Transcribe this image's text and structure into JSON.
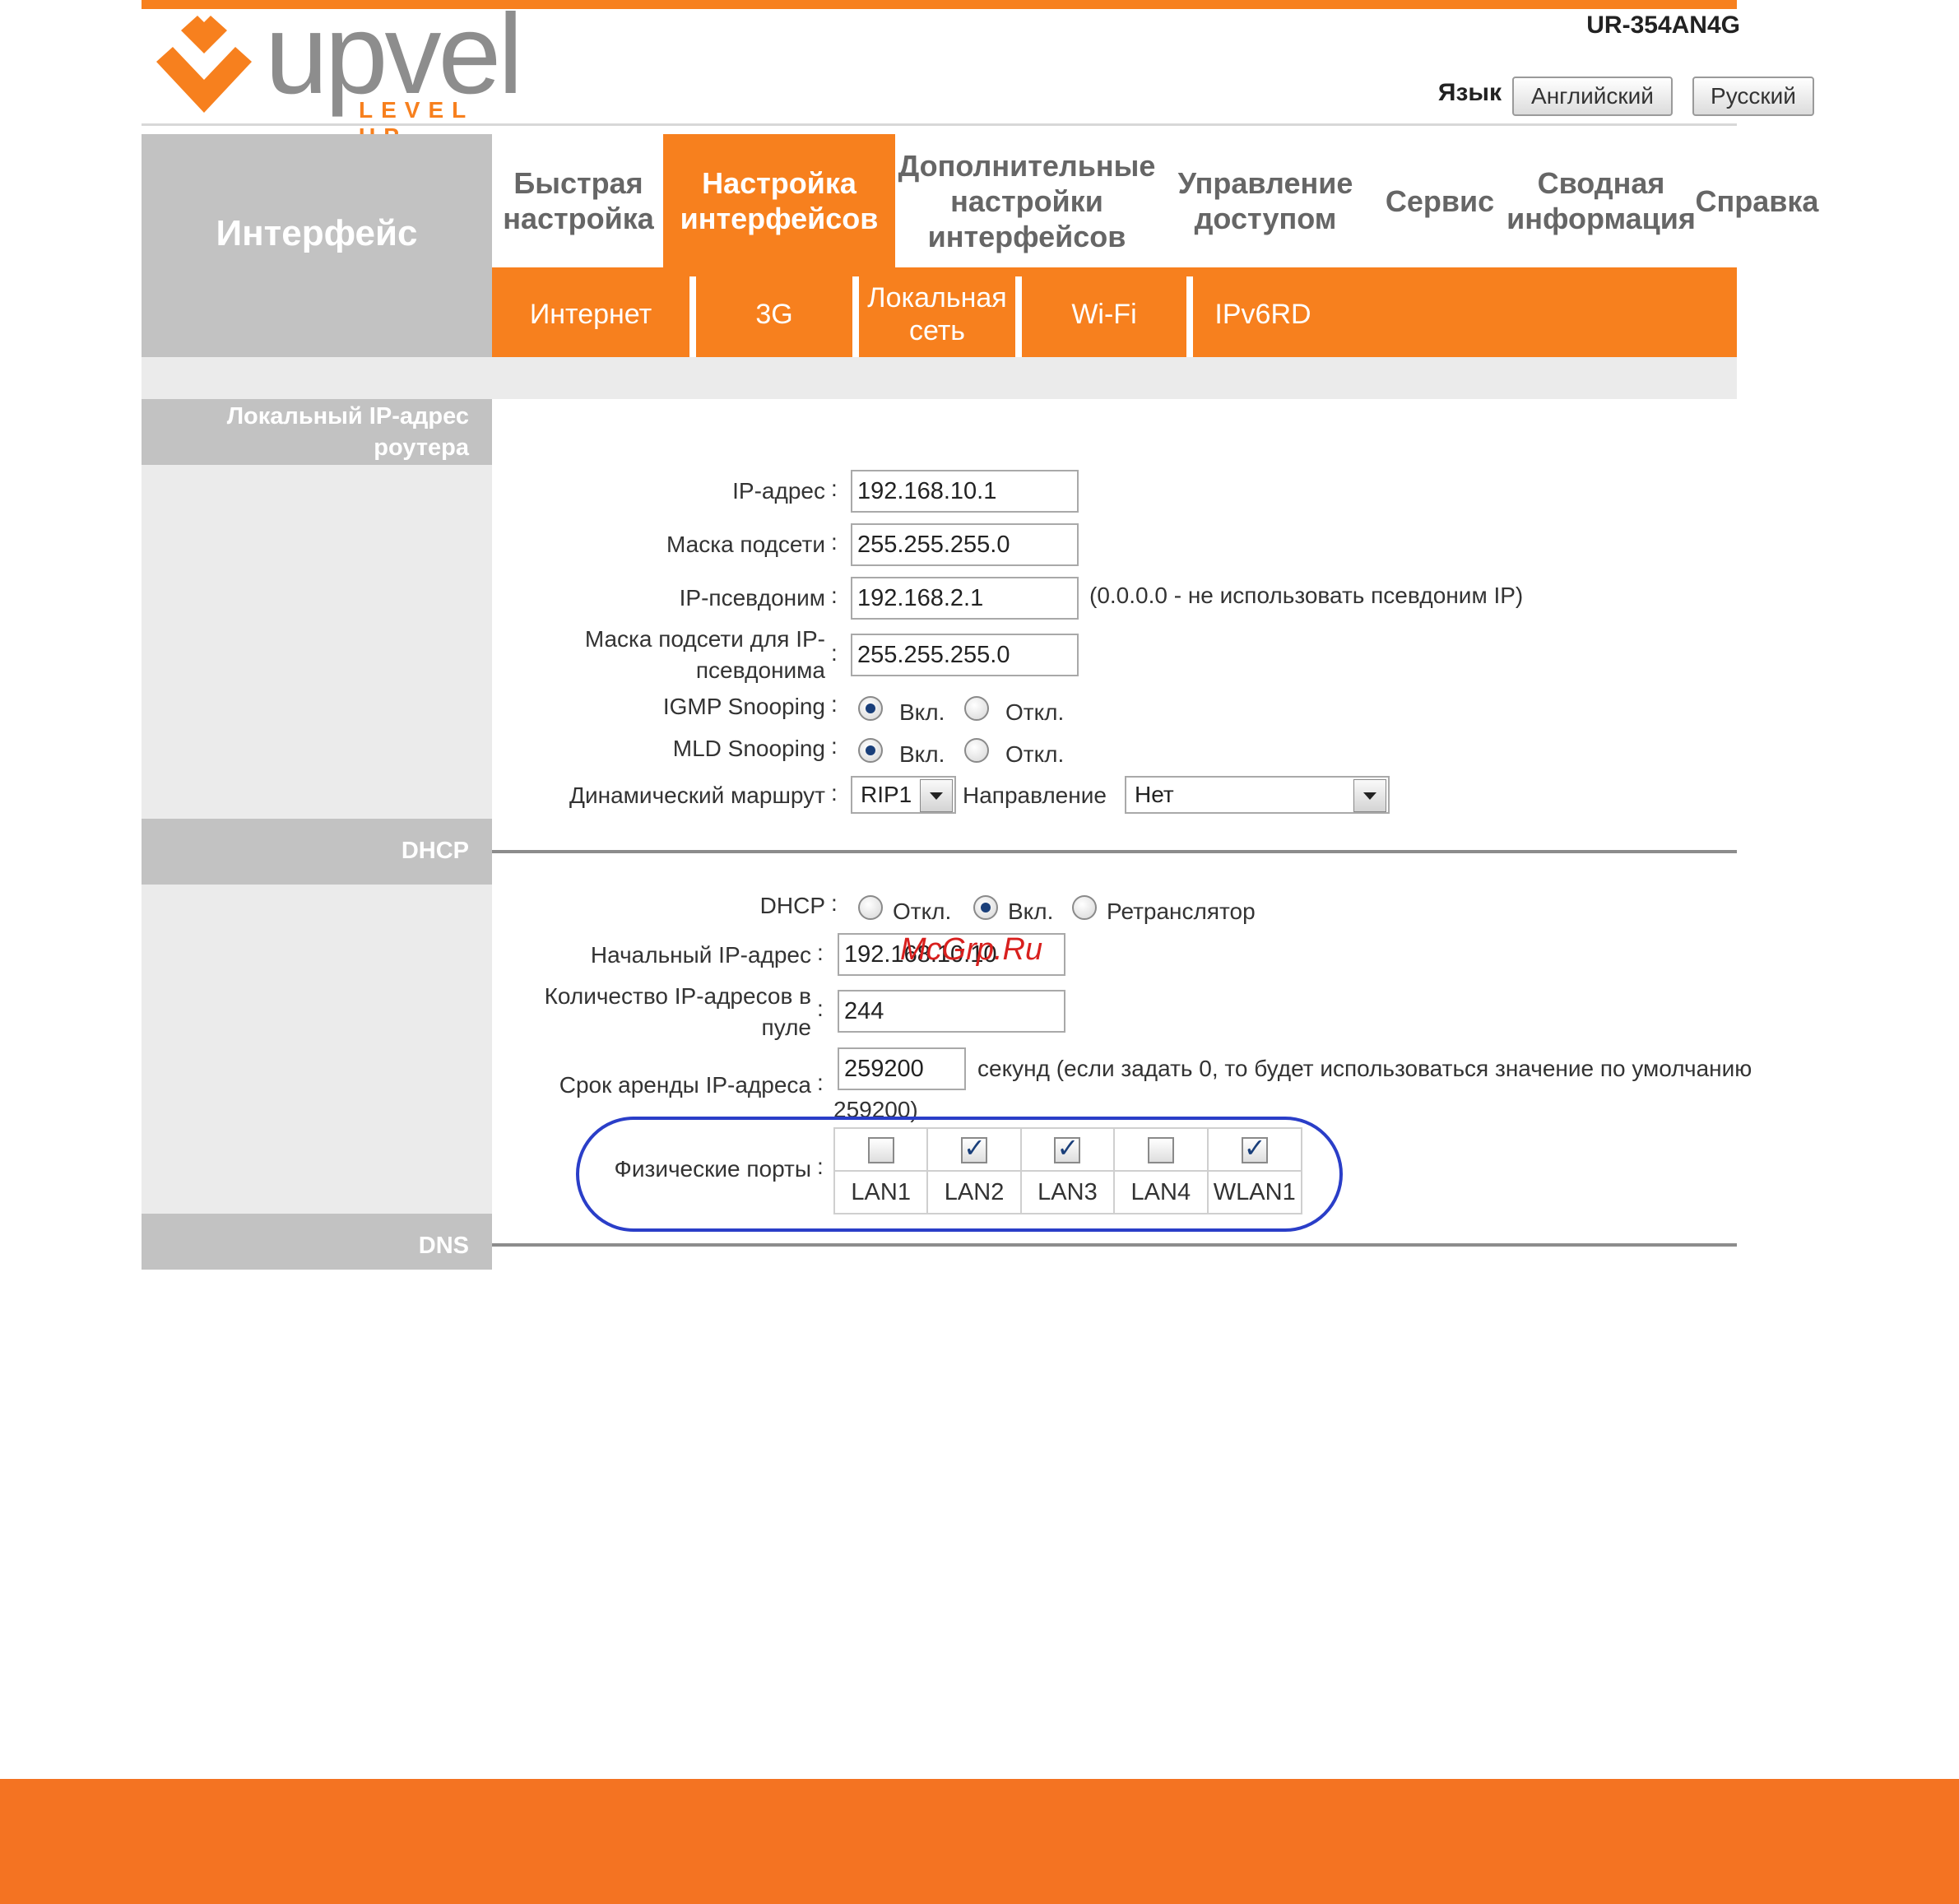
{
  "brand": {
    "logo_word": "upvel",
    "logo_tagline": "LEVEL UP",
    "model": "UR-354AN4G",
    "accent_color": "#f7801e"
  },
  "language": {
    "label": "Язык",
    "buttons": [
      "Английский",
      "Русский"
    ]
  },
  "sidebar": {
    "title": "Интерфейс"
  },
  "nav": {
    "items": [
      "Быстрая настройка",
      "Настройка интерфейсов",
      "Дополнительные настройки интерфейсов",
      "Управление доступом",
      "Сервис",
      "Сводная информация",
      "Справка"
    ],
    "active": "Настройка интерфейсов"
  },
  "subnav": {
    "items": [
      "Интернет",
      "3G",
      "Локальная сеть",
      "Wi-Fi",
      "IPv6RD"
    ]
  },
  "sections": {
    "lan": "Локальный IP-адрес роутера",
    "dhcp": "DHCP",
    "dns": "DNS"
  },
  "lan": {
    "ip_label": "IP-адрес",
    "ip_value": "192.168.10.1",
    "mask_label": "Маска подсети",
    "mask_value": "255.255.255.0",
    "alias_label": "IP-псевдоним",
    "alias_value": "192.168.2.1",
    "alias_note": "(0.0.0.0 - не использовать псевдоним IP)",
    "alias_mask_label": "Маска подсети для IP-псевдонима",
    "alias_mask_value": "255.255.255.0",
    "igmp_label": "IGMP Snooping",
    "mld_label": "MLD Snooping",
    "on_label": "Вкл.",
    "off_label": "Откл.",
    "igmp_state": "on",
    "mld_state": "on",
    "route_label": "Динамический маршрут",
    "route_value": "RIP1",
    "direction_label": "Направление",
    "direction_value": "Нет"
  },
  "dhcp": {
    "mode_label": "DHCP",
    "options": [
      "Откл.",
      "Вкл.",
      "Ретранслятор"
    ],
    "selected": "Вкл.",
    "start_label": "Начальный IP-адрес",
    "start_value": "192.168.10.10",
    "pool_label": "Количество IP-адресов в пуле",
    "pool_value": "244",
    "lease_label": "Срок аренды IP-адреса",
    "lease_value": "259200",
    "lease_note": "секунд (если задать 0, то будет использоваться значение по умолчанию",
    "lease_note_2": "259200)",
    "ports_label": "Физические порты",
    "ports": [
      {
        "name": "LAN1",
        "checked": false
      },
      {
        "name": "LAN2",
        "checked": true
      },
      {
        "name": "LAN3",
        "checked": true
      },
      {
        "name": "LAN4",
        "checked": false
      },
      {
        "name": "WLAN1",
        "checked": true
      }
    ]
  },
  "watermark": "McGrp.Ru"
}
